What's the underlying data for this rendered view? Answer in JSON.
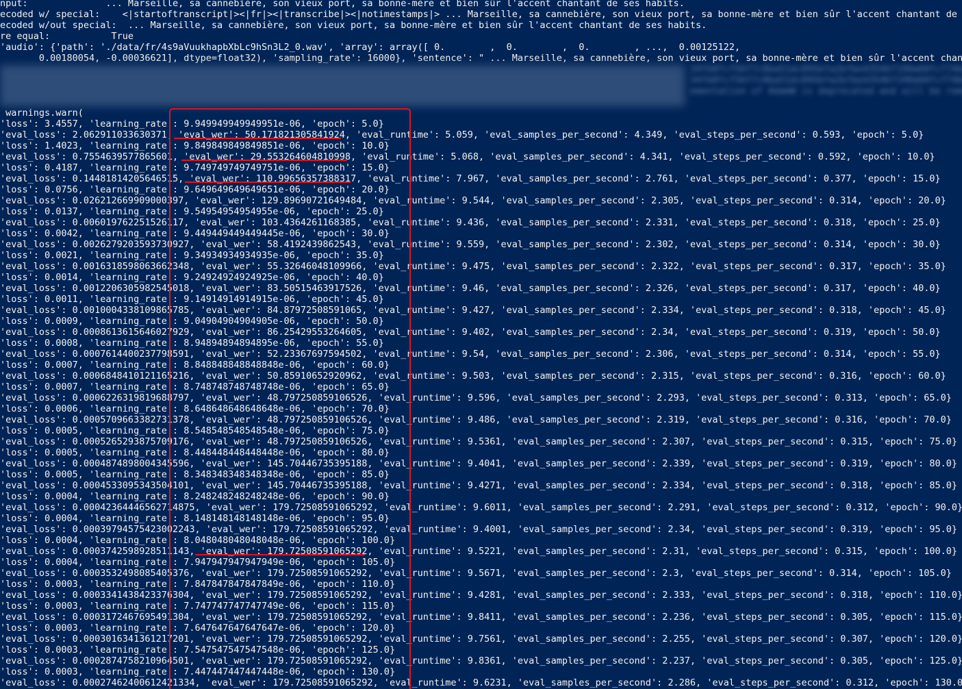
{
  "terminal": {
    "header_lines": [
      "nput:              ... Marseille, sa cannebière, son vieux port, sa bonne-mère et bien sûr l'accent chantant de ses habits.",
      "ecoded w/ special:    <|startoftranscript|><|fr|><|transcribe|><|notimestamps|> ... Marseille, sa cannebière, son vieux port, sa bonne-mère et bien sûr l'accent chantant de ses",
      "ecoded w/out special:  ... Marseille, sa cannebière, son vieux port, sa bonne-mère et bien sûr l'accent chantant de ses habits.",
      "re equal:           True",
      "'audio': {'path': './data/fr/4s9aVuukhapbXbLc9hSn3L2_0.wav', 'array': array([ 0.        ,  0.        ,  0.        , ...,  0.00125122,",
      "       0.00180054, -0.00036621], dtype=float32), 'sampling_rate': 16000}, 'sentence': \" ... Marseille, sa cannebière, son vieux port, sa bonne-mère et bien sûr l'accent chantan"
    ],
    "blurred_lines": [
      "34fb8fcf56f7c8ba51dc895bfa2bfbe43546f190a60fcf74bb",
      "34fb8fcf56f7c8ba51dc895bfa2bfbe43546f190a60fcf74bb",
      "ementation of AdamW is deprecated and will be remov"
    ],
    "warn_line": " warnings.warn(",
    "log_lines": [
      "'loss': 3.4557, 'learning_rate': 9.949949949949951e-06, 'epoch': 5.0}",
      "'eval_loss': 2.062911033630371, 'eval_wer': 50.171821305841924, 'eval_runtime': 5.059, 'eval_samples_per_second': 4.349, 'eval_steps_per_second': 0.593, 'epoch': 5.0}",
      "'loss': 1.4023, 'learning_rate': 9.849849849849851e-06, 'epoch': 10.0}",
      "'eval_loss': 0.7554639577865601, 'eval_wer': 29.553264604810998, 'eval_runtime': 5.068, 'eval_samples_per_second': 4.341, 'eval_steps_per_second': 0.592, 'epoch': 10.0}",
      "'loss': 0.4187, 'learning_rate': 9.749749749749751e-06, 'epoch': 15.0}",
      "'eval_loss': 0.14481814205646515, 'eval_wer': 110.99656357388317, 'eval_runtime': 7.967, 'eval_samples_per_second': 2.761, 'eval_steps_per_second': 0.377, 'epoch': 15.0}",
      "'loss': 0.0756, 'learning_rate': 9.649649649649651e-06, 'epoch': 20.0}",
      "'eval_loss': 0.026212669909000397, 'eval_wer': 129.89690721649484, 'eval_runtime': 9.544, 'eval_samples_per_second': 2.305, 'eval_steps_per_second': 0.314, 'epoch': 20.0}",
      "'loss': 0.0137, 'learning_rate': 9.54954954954955e-06, 'epoch': 25.0}",
      "'eval_loss': 0.006019762251526117, 'eval_wer': 103.4364261168385, 'eval_runtime': 9.436, 'eval_samples_per_second': 2.331, 'eval_steps_per_second': 0.318, 'epoch': 25.0}",
      "'loss': 0.0042, 'learning_rate': 9.449449449449445e-06, 'epoch': 30.0}",
      "'eval_loss': 0.0026279203593730927, 'eval_wer': 58.4192439862543, 'eval_runtime': 9.559, 'eval_samples_per_second': 2.302, 'eval_steps_per_second': 0.314, 'epoch': 30.0}",
      "'loss': 0.0021, 'learning_rate': 9.34934934934935e-06, 'epoch': 35.0}",
      "'eval_loss': 0.0016318598063662348, 'eval_wer': 55.32646048109966, 'eval_runtime': 9.475, 'eval_samples_per_second': 2.322, 'eval_steps_per_second': 0.317, 'epoch': 35.0}",
      "'loss': 0.0014, 'learning_rate': 9.24924924924925e-06, 'epoch': 40.0}",
      "'eval_loss': 0.0012206305982545018, 'eval_wer': 83.50515463917526, 'eval_runtime': 9.46, 'eval_samples_per_second': 2.326, 'eval_steps_per_second': 0.317, 'epoch': 40.0}",
      "'loss': 0.0011, 'learning_rate': 9.14914914914915e-06, 'epoch': 45.0}",
      "'eval_loss': 0.0010004338109865785, 'eval_wer': 84.87972508591065, 'eval_runtime': 9.427, 'eval_samples_per_second': 2.334, 'eval_steps_per_second': 0.318, 'epoch': 45.0}",
      "'loss': 0.0009, 'learning_rate': 9.04904904904905e-06, 'epoch': 50.0}",
      "'eval_loss': 0.0008613615646027929, 'eval_wer': 86.25429553264605, 'eval_runtime': 9.402, 'eval_samples_per_second': 2.34, 'eval_steps_per_second': 0.319, 'epoch': 50.0}",
      "'loss': 0.0008, 'learning_rate': 8.94894894894895e-06, 'epoch': 55.0}",
      "'eval_loss': 0.0007614400237798591, 'eval_wer': 52.23367697594502, 'eval_runtime': 9.54, 'eval_samples_per_second': 2.306, 'eval_steps_per_second': 0.314, 'epoch': 55.0}",
      "'loss': 0.0007, 'learning_rate': 8.848848848848848e-06, 'epoch': 60.0}",
      "'eval_loss': 0.0006848410121165216, 'eval_wer': 50.85910652920962, 'eval_runtime': 9.503, 'eval_samples_per_second': 2.315, 'eval_steps_per_second': 0.316, 'epoch': 60.0}",
      "'loss': 0.0007, 'learning_rate': 8.748748748748748e-06, 'epoch': 65.0}",
      "'eval_loss': 0.0006226319819688797, 'eval_wer': 48.797250859106526, 'eval_runtime': 9.596, 'eval_samples_per_second': 2.293, 'eval_steps_per_second': 0.313, 'epoch': 65.0}",
      "'loss': 0.0006, 'learning_rate': 8.648648648648648e-06, 'epoch': 70.0}",
      "'eval_loss': 0.0005709663382731378, 'eval_wer': 48.797250859106526, 'eval_runtime': 9.486, 'eval_samples_per_second': 2.319, 'eval_steps_per_second': 0.316, 'epoch': 70.0}",
      "'loss': 0.0005, 'learning_rate': 8.548548548548548e-06, 'epoch': 75.0}",
      "'eval_loss': 0.0005265293875709176, 'eval_wer': 48.797250859106526, 'eval_runtime': 9.5361, 'eval_samples_per_second': 2.307, 'eval_steps_per_second': 0.315, 'epoch': 75.0}",
      "'loss': 0.0005, 'learning_rate': 8.448448448448448e-06, 'epoch': 80.0}",
      "'eval_loss': 0.0004874898004345596, 'eval_wer': 145.70446735395188, 'eval_runtime': 9.4041, 'eval_samples_per_second': 2.339, 'eval_steps_per_second': 0.319, 'epoch': 80.0}",
      "'loss': 0.0005, 'learning_rate': 8.348348348348348e-06, 'epoch': 85.0}",
      "'eval_loss': 0.0004533095343504101, 'eval_wer': 145.70446735395188, 'eval_runtime': 9.4271, 'eval_samples_per_second': 2.334, 'eval_steps_per_second': 0.318, 'epoch': 85.0}",
      "'loss': 0.0004, 'learning_rate': 8.248248248248248e-06, 'epoch': 90.0}",
      "'eval_loss': 0.00042364446562714875, 'eval_wer': 179.72508591065292, 'eval_runtime': 9.6011, 'eval_samples_per_second': 2.291, 'eval_steps_per_second': 0.312, 'epoch': 90.0}",
      "'loss': 0.0004, 'learning_rate': 8.148148148148148e-06, 'epoch': 95.0}",
      "'eval_loss': 0.00039794575423002243, 'eval_wer': 179.72508591065292, 'eval_runtime': 9.4001, 'eval_samples_per_second': 2.34, 'eval_steps_per_second': 0.319, 'epoch': 95.0}",
      "'loss': 0.0004, 'learning_rate': 8.048048048048048e-06, 'epoch': 100.0}",
      "'eval_loss': 0.0003742598928511143, 'eval_wer': 179.72508591065292, 'eval_runtime': 9.5221, 'eval_samples_per_second': 2.31, 'eval_steps_per_second': 0.315, 'epoch': 100.0}",
      "'loss': 0.0004, 'learning_rate': 7.947947947947949e-06, 'epoch': 105.0}",
      "'eval_loss': 0.0003532498085405376, 'eval_wer': 179.72508591065292, 'eval_runtime': 9.5671, 'eval_samples_per_second': 2.3, 'eval_steps_per_second': 0.314, 'epoch': 105.0}",
      "'loss': 0.0003, 'learning_rate': 7.847847847847849e-06, 'epoch': 110.0}",
      "'eval_loss': 0.0003341438423376304, 'eval_wer': 179.72508591065292, 'eval_runtime': 9.4281, 'eval_samples_per_second': 2.333, 'eval_steps_per_second': 0.318, 'epoch': 110.0}",
      "'loss': 0.0003, 'learning_rate': 7.747747747747749e-06, 'epoch': 115.0}",
      "'eval_loss': 0.0003172467695491304, 'eval_wer': 179.72508591065292, 'eval_runtime': 9.8411, 'eval_samples_per_second': 2.236, 'eval_steps_per_second': 0.305, 'epoch': 115.0}",
      "'loss': 0.0003, 'learning_rate': 7.647647647647647e-06, 'epoch': 120.0}",
      "'eval_loss': 0.0003016341361217201, 'eval_wer': 179.72508591065292, 'eval_runtime': 9.7561, 'eval_samples_per_second': 2.255, 'eval_steps_per_second': 0.307, 'epoch': 120.0}",
      "'loss': 0.0003, 'learning_rate': 7.547547547547548e-06, 'epoch': 125.0}",
      "'eval_loss': 0.0002874758210964501, 'eval_wer': 179.72508591065292, 'eval_runtime': 9.8361, 'eval_samples_per_second': 2.237, 'eval_steps_per_second': 0.305, 'epoch': 125.0}",
      "'loss': 0.0003, 'learning_rate': 7.447447447447448e-06, 'epoch': 130.0}",
      "'eval_loss': 0.00027462400612421334, 'eval_wer': 179.72508591065292, 'eval_runtime': 9.6231, 'eval_samples_per_second': 2.286, 'eval_steps_per_second': 0.312, 'epoch': 130.0}"
    ]
  },
  "annotation": {
    "color": "#e0141e"
  },
  "colors": {
    "background": "#012456",
    "foreground": "#f2f2f2"
  }
}
